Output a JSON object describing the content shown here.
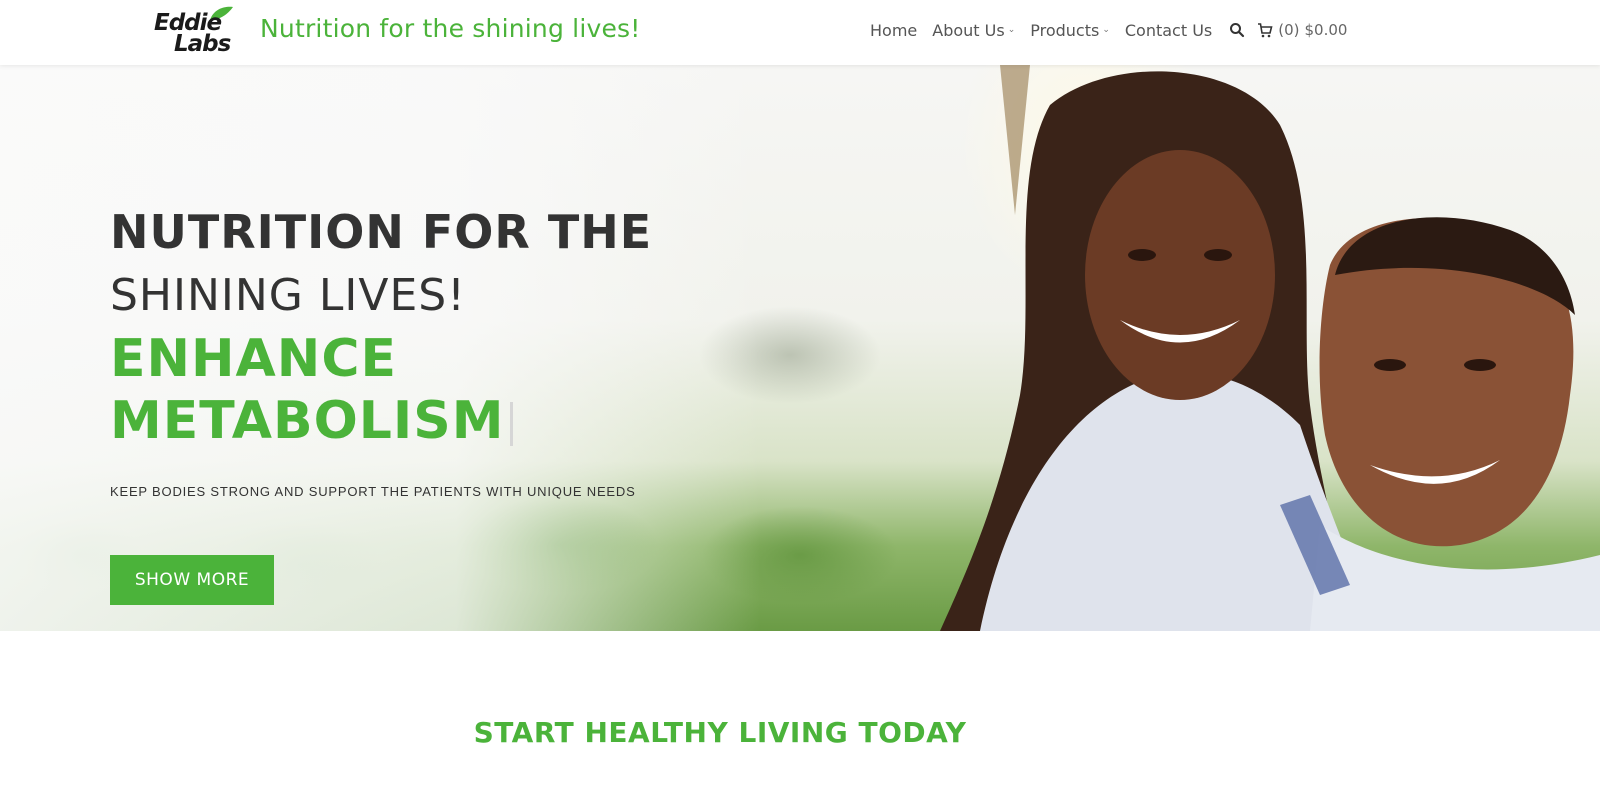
{
  "header": {
    "logo_line1": "Eddie",
    "logo_line2": "Labs",
    "tagline": "Nutrition for the shining lives!",
    "nav": {
      "home": "Home",
      "about": "About Us",
      "products": "Products",
      "contact": "Contact Us"
    },
    "cart": {
      "count": "(0)",
      "total": "$0.00"
    }
  },
  "hero": {
    "line1": "NUTRITION FOR THE",
    "line2": "SHINING LIVES!",
    "line3": "ENHANCE METABOLISM",
    "subtitle": "KEEP BODIES STRONG AND SUPPORT THE PATIENTS WITH UNIQUE NEEDS",
    "button_label": "SHOW MORE"
  },
  "section": {
    "title": "START HEALTHY LIVING TODAY"
  },
  "colors": {
    "brand_green": "#4bb33a",
    "text_dark": "#333333",
    "nav_text": "#555555"
  },
  "icons": [
    "leaf-icon",
    "caret-down-icon",
    "search-icon",
    "cart-icon"
  ]
}
